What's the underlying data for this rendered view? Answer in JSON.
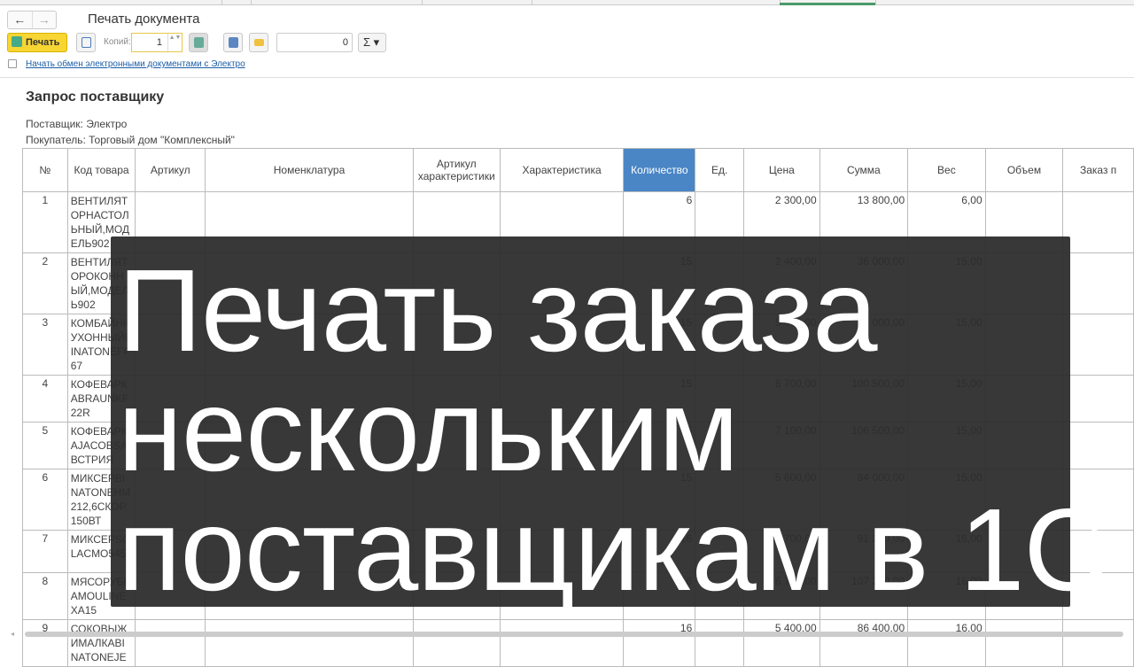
{
  "window": {
    "title": "Печать документа",
    "back": "←",
    "forward": "→"
  },
  "toolbar": {
    "print_label": "Печать",
    "copies_label": "Копий:",
    "copies_value": "1",
    "spin": "▲▼",
    "number_value": "0",
    "sum_label": "Σ ▾"
  },
  "link": "Начать обмен электронными документами с Электро",
  "document": {
    "title": "Запрос поставщику",
    "supplier": "Поставщик: Электро",
    "buyer": "Покупатель: Торговый дом \"Комплексный\""
  },
  "table": {
    "headers": [
      "№",
      "Код товара",
      "Артикул",
      "Номенклатура",
      "Артикул характеристики",
      "Характеристика",
      "Количество",
      "Ед.",
      "Цена",
      "Сумма",
      "Вес",
      "Объем",
      "Заказ п"
    ],
    "rows": [
      {
        "n": "1",
        "code": "ВЕНТИЛЯТОРНАСТОЛЬНЫЙ,МОДЕЛЬ902",
        "qty": "6",
        "price": "2 300,00",
        "sum": "13 800,00",
        "weight": "6,00"
      },
      {
        "n": "2",
        "code": "ВЕНТИЛЯТОРОКОННЫЙ,МОДЕЛЬ902",
        "qty": "15",
        "price": "2 400,00",
        "sum": "36 000,00",
        "weight": "15,00"
      },
      {
        "n": "3",
        "code": "КОМБАЙНКУХОННЫЙBINATONEFP67",
        "qty": "15",
        "price": "5 400,00",
        "sum": "81 000,00",
        "weight": "15,00"
      },
      {
        "n": "4",
        "code": "КОФЕВАРКABRAUNKF22R",
        "qty": "15",
        "price": "6 700,00",
        "sum": "100 500,00",
        "weight": "15,00"
      },
      {
        "n": "5",
        "code": "КОФЕВАРКAJACOBSАВСТРИЯ",
        "qty": "15",
        "price": "7 100,00",
        "sum": "106 500,00",
        "weight": "15,00"
      },
      {
        "n": "6",
        "code": "МИКСЕРBINATONEHM212,6СКОР,150ВТ",
        "qty": "15",
        "price": "5 600,00",
        "sum": "84 000,00",
        "weight": "15,00"
      },
      {
        "n": "7",
        "code": "МИКСЕРSOLACMO545",
        "qty": "16",
        "price": "5 700,00",
        "sum": "91 200,00",
        "weight": "16,00"
      },
      {
        "n": "8",
        "code": "МЯСОРУБКАMOULINEXA15",
        "qty": "16",
        "price": "6 700,00",
        "sum": "107 200,00",
        "weight": "16,00"
      },
      {
        "n": "9",
        "code": "СОКОВЫЖИМАЛКАBINATONEJE",
        "qty": "16",
        "price": "5 400,00",
        "sum": "86 400,00",
        "weight": "16,00"
      }
    ]
  },
  "overlay": {
    "lines": [
      "Печать заказа",
      "нескольким",
      "поставщикам в 1С"
    ]
  },
  "colors": {
    "print_button": "#f7d533",
    "highlight_header": "#4a86c5",
    "link": "#1c5fa8",
    "overlay": "#2c2c2c"
  }
}
